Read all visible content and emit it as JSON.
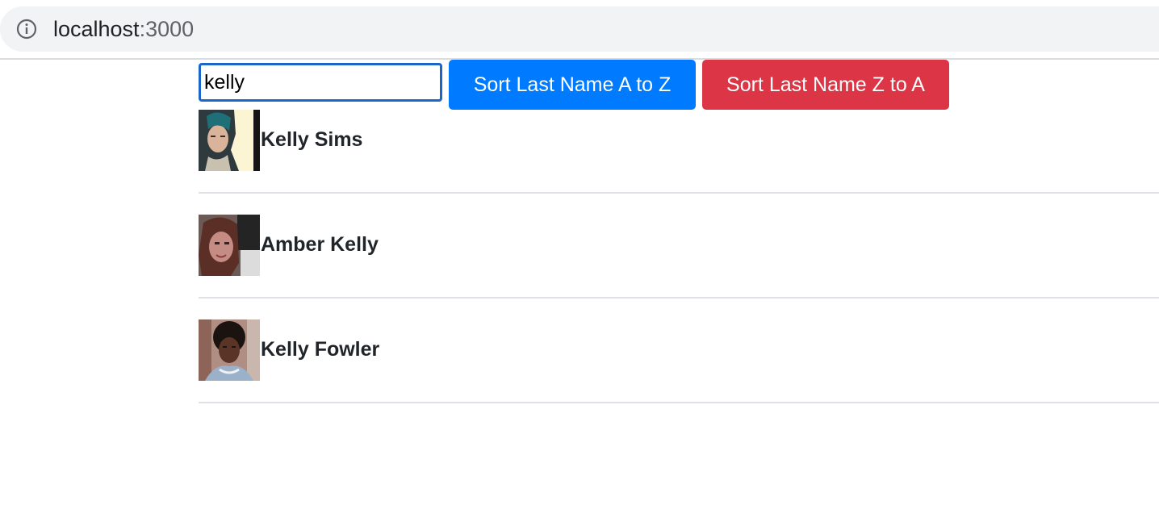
{
  "browser": {
    "url_host": "localhost",
    "url_port": ":3000",
    "icon": "info-icon"
  },
  "search": {
    "value": "kelly"
  },
  "buttons": {
    "sort_asc_label": "Sort Last Name A to Z",
    "sort_asc_color": "#007bff",
    "sort_desc_label": "Sort Last Name Z to A",
    "sort_desc_color": "#dc3545"
  },
  "employees": [
    {
      "name": "Kelly Sims",
      "avatar": "avatar-photo"
    },
    {
      "name": "Amber Kelly",
      "avatar": "avatar-photo"
    },
    {
      "name": "Kelly Fowler",
      "avatar": "avatar-photo"
    }
  ]
}
